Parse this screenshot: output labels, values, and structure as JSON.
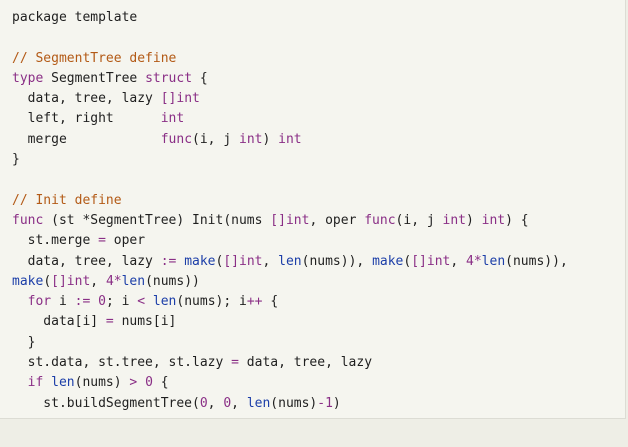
{
  "code": {
    "lines": [
      [
        {
          "t": "package template",
          "c": ""
        }
      ],
      [],
      [
        {
          "t": "// SegmentTree define",
          "c": "cm"
        }
      ],
      [
        {
          "t": "type",
          "c": "kw"
        },
        {
          "t": " SegmentTree ",
          "c": ""
        },
        {
          "t": "struct",
          "c": "kw"
        },
        {
          "t": " {",
          "c": ""
        }
      ],
      [
        {
          "t": "  data, tree, lazy ",
          "c": ""
        },
        {
          "t": "[]int",
          "c": "ty"
        }
      ],
      [
        {
          "t": "  left, right      ",
          "c": ""
        },
        {
          "t": "int",
          "c": "ty"
        }
      ],
      [
        {
          "t": "  merge            ",
          "c": ""
        },
        {
          "t": "func",
          "c": "kw"
        },
        {
          "t": "(i, j ",
          "c": ""
        },
        {
          "t": "int",
          "c": "ty"
        },
        {
          "t": ") ",
          "c": ""
        },
        {
          "t": "int",
          "c": "ty"
        }
      ],
      [
        {
          "t": "}",
          "c": ""
        }
      ],
      [],
      [
        {
          "t": "// Init define",
          "c": "cm"
        }
      ],
      [
        {
          "t": "func",
          "c": "kw"
        },
        {
          "t": " (st *SegmentTree) Init(nums ",
          "c": ""
        },
        {
          "t": "[]int",
          "c": "ty"
        },
        {
          "t": ", oper ",
          "c": ""
        },
        {
          "t": "func",
          "c": "kw"
        },
        {
          "t": "(i, j ",
          "c": ""
        },
        {
          "t": "int",
          "c": "ty"
        },
        {
          "t": ") ",
          "c": ""
        },
        {
          "t": "int",
          "c": "ty"
        },
        {
          "t": ") {",
          "c": ""
        }
      ],
      [
        {
          "t": "  st.merge ",
          "c": ""
        },
        {
          "t": "=",
          "c": "op"
        },
        {
          "t": " oper",
          "c": ""
        }
      ],
      [
        {
          "t": "  data, tree, lazy ",
          "c": ""
        },
        {
          "t": ":=",
          "c": "op"
        },
        {
          "t": " ",
          "c": ""
        },
        {
          "t": "make",
          "c": "fn"
        },
        {
          "t": "(",
          "c": ""
        },
        {
          "t": "[]int",
          "c": "ty"
        },
        {
          "t": ", ",
          "c": ""
        },
        {
          "t": "len",
          "c": "fn"
        },
        {
          "t": "(nums)), ",
          "c": ""
        },
        {
          "t": "make",
          "c": "fn"
        },
        {
          "t": "(",
          "c": ""
        },
        {
          "t": "[]int",
          "c": "ty"
        },
        {
          "t": ", ",
          "c": ""
        },
        {
          "t": "4",
          "c": "num"
        },
        {
          "t": "*",
          "c": "op"
        },
        {
          "t": "len",
          "c": "fn"
        },
        {
          "t": "(nums)),",
          "c": ""
        }
      ],
      [
        {
          "t": "make",
          "c": "fn"
        },
        {
          "t": "(",
          "c": ""
        },
        {
          "t": "[]int",
          "c": "ty"
        },
        {
          "t": ", ",
          "c": ""
        },
        {
          "t": "4",
          "c": "num"
        },
        {
          "t": "*",
          "c": "op"
        },
        {
          "t": "len",
          "c": "fn"
        },
        {
          "t": "(nums))",
          "c": ""
        }
      ],
      [
        {
          "t": "  ",
          "c": ""
        },
        {
          "t": "for",
          "c": "kw"
        },
        {
          "t": " i ",
          "c": ""
        },
        {
          "t": ":=",
          "c": "op"
        },
        {
          "t": " ",
          "c": ""
        },
        {
          "t": "0",
          "c": "num"
        },
        {
          "t": "; i ",
          "c": ""
        },
        {
          "t": "<",
          "c": "op"
        },
        {
          "t": " ",
          "c": ""
        },
        {
          "t": "len",
          "c": "fn"
        },
        {
          "t": "(nums); i",
          "c": ""
        },
        {
          "t": "++",
          "c": "op"
        },
        {
          "t": " {",
          "c": ""
        }
      ],
      [
        {
          "t": "    data[i] ",
          "c": ""
        },
        {
          "t": "=",
          "c": "op"
        },
        {
          "t": " nums[i]",
          "c": ""
        }
      ],
      [
        {
          "t": "  }",
          "c": ""
        }
      ],
      [
        {
          "t": "  st.data, st.tree, st.lazy ",
          "c": ""
        },
        {
          "t": "=",
          "c": "op"
        },
        {
          "t": " data, tree, lazy",
          "c": ""
        }
      ],
      [
        {
          "t": "  ",
          "c": ""
        },
        {
          "t": "if",
          "c": "kw"
        },
        {
          "t": " ",
          "c": ""
        },
        {
          "t": "len",
          "c": "fn"
        },
        {
          "t": "(nums) ",
          "c": ""
        },
        {
          "t": ">",
          "c": "op"
        },
        {
          "t": " ",
          "c": ""
        },
        {
          "t": "0",
          "c": "num"
        },
        {
          "t": " {",
          "c": ""
        }
      ],
      [
        {
          "t": "    st.buildSegmentTree(",
          "c": ""
        },
        {
          "t": "0",
          "c": "num"
        },
        {
          "t": ", ",
          "c": ""
        },
        {
          "t": "0",
          "c": "num"
        },
        {
          "t": ", ",
          "c": ""
        },
        {
          "t": "len",
          "c": "fn"
        },
        {
          "t": "(nums)",
          "c": ""
        },
        {
          "t": "-",
          "c": "op"
        },
        {
          "t": "1",
          "c": "num"
        },
        {
          "t": ")",
          "c": ""
        }
      ]
    ]
  },
  "colors": {
    "keyword": "#8a2f86",
    "builtin": "#1c3ea8",
    "comment": "#b35a16",
    "text": "#1f1f1f",
    "background": "#f5f5ef"
  }
}
